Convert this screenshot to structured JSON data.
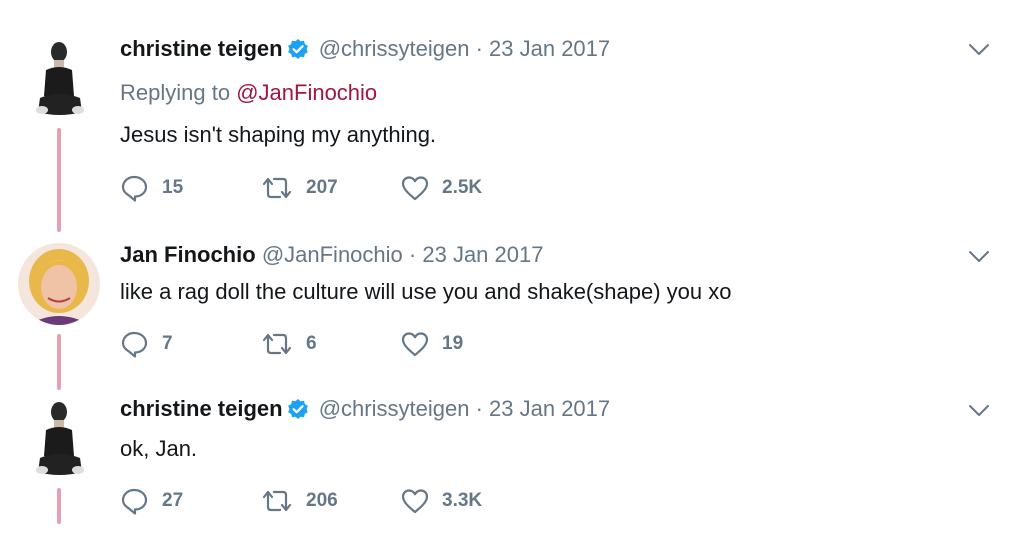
{
  "tweets": [
    {
      "name": "christine teigen",
      "verified": true,
      "handle": "@chrissyteigen",
      "separator": "·",
      "date": "23 Jan 2017",
      "replying_prefix": "Replying to",
      "replying_to": "@JanFinochio",
      "text": "Jesus isn't shaping my anything.",
      "replies": "15",
      "retweets": "207",
      "likes": "2.5K"
    },
    {
      "name": "Jan Finochio",
      "verified": false,
      "handle": "@JanFinochio",
      "separator": "·",
      "date": "23 Jan 2017",
      "text": "like a rag doll the culture will use you and shake(shape) you xo",
      "replies": "7",
      "retweets": "6",
      "likes": "19"
    },
    {
      "name": "christine teigen",
      "verified": true,
      "handle": "@chrissyteigen",
      "separator": "·",
      "date": "23 Jan 2017",
      "text": "ok, Jan.",
      "replies": "27",
      "retweets": "206",
      "likes": "3.3K"
    }
  ],
  "icons": {
    "reply": "reply-icon",
    "retweet": "retweet-icon",
    "like": "heart-icon",
    "verified": "verified-badge-icon",
    "menu": "chevron-down-icon"
  },
  "colors": {
    "thread_line": "#e3a0b2",
    "verified": "#1da1f2",
    "mention": "#a0163f",
    "secondary_text": "#657786"
  }
}
